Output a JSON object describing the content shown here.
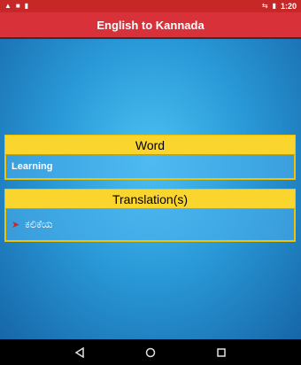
{
  "status_bar": {
    "time": "1:20",
    "left_icons": [
      "alert-icon",
      "app-icon",
      "sd-card-icon"
    ],
    "right_icons": [
      "wifi-arrows-icon",
      "battery-icon"
    ]
  },
  "app_bar": {
    "title": "English to Kannada"
  },
  "word_panel": {
    "header": "Word",
    "value": "Learning"
  },
  "translation_panel": {
    "header": "Translation(s)",
    "items": [
      "ಕಲಿಕೆಯ"
    ]
  },
  "nav_bar": {
    "icons": [
      "back-icon",
      "home-icon",
      "recents-icon"
    ]
  },
  "colors": {
    "status": "#c62828",
    "appbar": "#d8313a",
    "panel_header": "#f9d52d"
  }
}
